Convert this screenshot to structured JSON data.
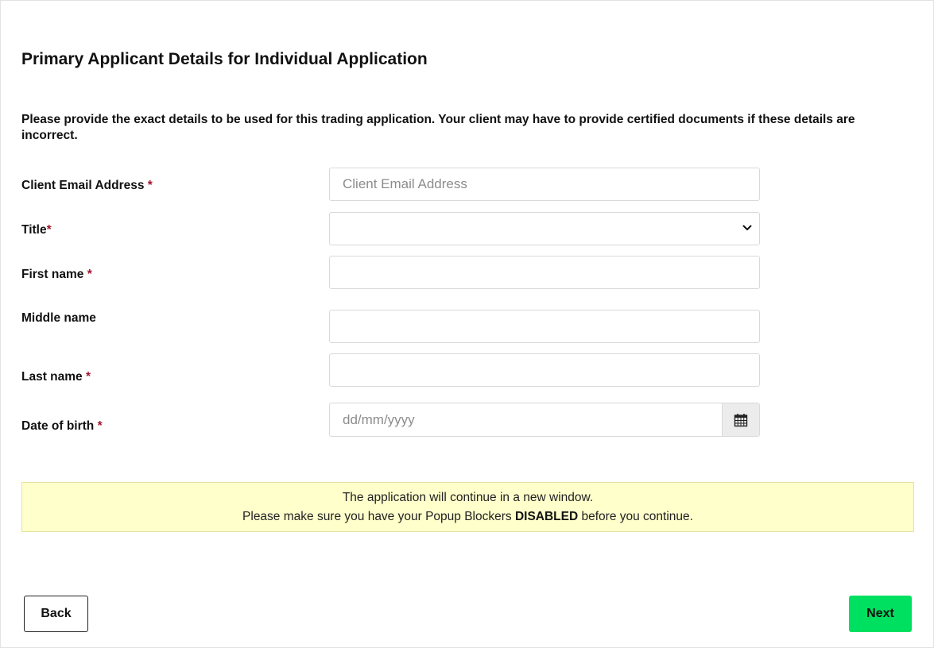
{
  "page_title": "Primary Applicant Details for Individual Application",
  "intro": "Please provide the exact details to be used for this trading application. Your client may have to provide certified documents if these details are incorrect.",
  "fields": {
    "email": {
      "label": "Client Email Address",
      "required_mark": "*",
      "placeholder": "Client Email Address",
      "value": ""
    },
    "title": {
      "label": "Title",
      "required_mark": "*",
      "value": ""
    },
    "first_name": {
      "label": "First name",
      "required_mark": "*",
      "value": ""
    },
    "middle_name": {
      "label": "Middle name",
      "value": ""
    },
    "last_name": {
      "label": "Last name",
      "required_mark": "*",
      "value": ""
    },
    "dob": {
      "label": "Date of birth",
      "required_mark": "*",
      "placeholder": "dd/mm/yyyy",
      "value": ""
    }
  },
  "notice": {
    "line1": "The application will continue in a new window.",
    "line2_pre": "Please make sure you have your Popup Blockers",
    "line2_bold": "DISABLED",
    "line2_post": "before you continue."
  },
  "buttons": {
    "back": "Back",
    "next": "Next"
  },
  "icons": {
    "title_select": "chevron-down-icon",
    "dob_picker": "calendar-icon"
  },
  "colors": {
    "required": "#a3162e",
    "next_button": "#00e060",
    "notice_bg": "#ffffcc"
  }
}
